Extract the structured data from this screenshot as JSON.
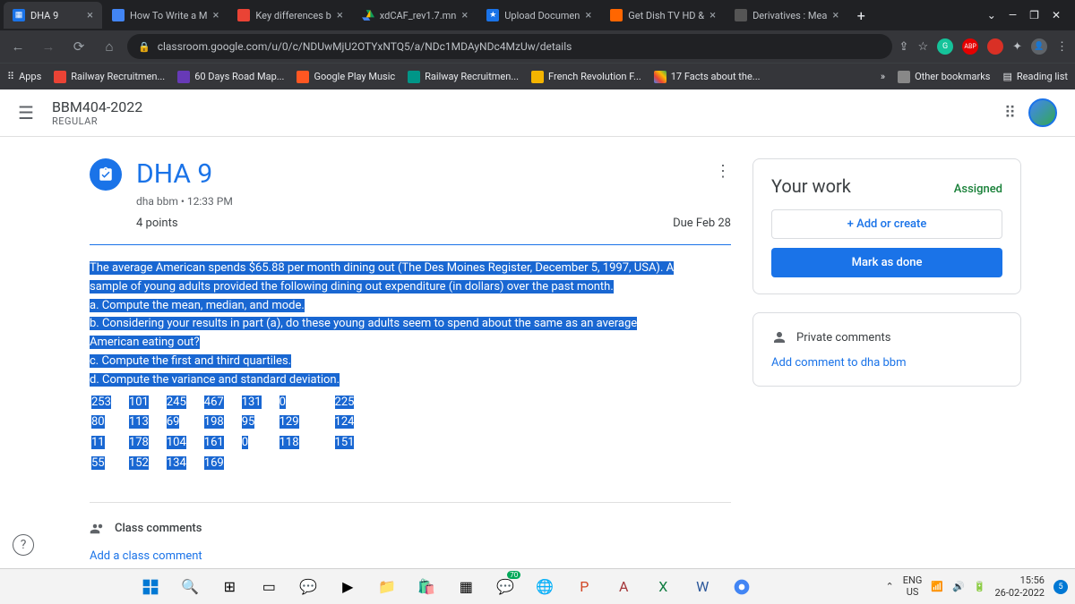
{
  "tabs": [
    {
      "title": "DHA 9",
      "active": true
    },
    {
      "title": "How To Write a M"
    },
    {
      "title": "Key differences b"
    },
    {
      "title": "xdCAF_rev1.7.mn"
    },
    {
      "title": "Upload Documen"
    },
    {
      "title": "Get Dish TV HD &"
    },
    {
      "title": "Derivatives : Mea"
    }
  ],
  "url": "classroom.google.com/u/0/c/NDUwMjU2OTYxNTQ5/a/NDc1MDAyNDc4MzUw/details",
  "bookmarks": {
    "apps": "Apps",
    "items": [
      "Railway Recruitmen...",
      "60 Days Road Map...",
      "Google Play Music",
      "Railway Recruitmen...",
      "French Revolution F...",
      "17 Facts about the..."
    ],
    "other": "Other bookmarks",
    "reading": "Reading list"
  },
  "classroom": {
    "course": "BBM404-2022",
    "course_sub": "REGULAR",
    "assignment_title": "DHA 9",
    "author": "dha bbm",
    "time": "12:33 PM",
    "points": "4 points",
    "due": "Due Feb 28",
    "question_lines": [
      "The average American spends $65.88 per month dining out (The Des Moines Register, December 5, 1997, USA). A",
      "sample of young adults provided the following dining out expenditure (in dollars) over the past month.",
      "a. Compute the mean, median, and mode.",
      "b. Considering your results in part (a), do these young adults seem to spend about the same as an average",
      "American eating out?",
      "c. Compute the first and third quartiles.",
      "d. Compute the variance and standard deviation."
    ],
    "data_rows": [
      [
        "253",
        "101",
        "245",
        "467",
        "131",
        "0",
        "",
        "225"
      ],
      [
        "80",
        "113",
        "69",
        "198",
        "95",
        "129",
        "",
        "124"
      ],
      [
        "11",
        "178",
        "104",
        "161",
        "0",
        "118",
        "",
        "151"
      ],
      [
        "55",
        "152",
        "134",
        "169",
        "",
        "",
        "",
        ""
      ]
    ],
    "class_comments": "Class comments",
    "add_class_comment": "Add a class comment",
    "your_work": "Your work",
    "status": "Assigned",
    "add_or_create": "+ Add or create",
    "mark_done": "Mark as done",
    "private_comments": "Private comments",
    "add_private": "Add comment to dha bbm"
  },
  "taskbar": {
    "lang1": "ENG",
    "lang2": "US",
    "time": "15:56",
    "date": "26-02-2022",
    "whatsapp_badge": "70",
    "notif": "5"
  }
}
